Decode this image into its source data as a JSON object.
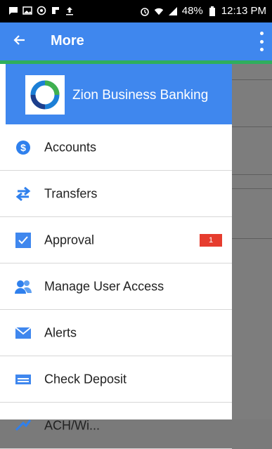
{
  "status_bar": {
    "battery": "48%",
    "time": "12:13 PM",
    "left_icons": [
      "chat-icon",
      "image-icon",
      "circle-icon",
      "flipboard-icon",
      "upload-icon"
    ],
    "right_icons": [
      "alarm-icon",
      "wifi-icon",
      "signal-icon",
      "battery-icon"
    ]
  },
  "app_bar": {
    "title": "More",
    "back_icon": "arrow-left-icon",
    "overflow_icon": "more-vert-icon"
  },
  "drawer": {
    "brand": "Zion Business Banking",
    "items": [
      {
        "label": "Accounts",
        "icon": "dollar-circle-icon"
      },
      {
        "label": "Transfers",
        "icon": "swap-arrows-icon"
      },
      {
        "label": "Approval",
        "icon": "checkbox-icon",
        "badge": "1"
      },
      {
        "label": "Manage User Access",
        "icon": "users-icon"
      },
      {
        "label": "Alerts",
        "icon": "envelope-icon"
      },
      {
        "label": "Check Deposit",
        "icon": "card-icon"
      },
      {
        "label": "ACH/Wi...",
        "icon": "ach-icon"
      }
    ]
  },
  "colors": {
    "primary": "#3f87ee",
    "accent_green": "#2fae5d",
    "badge_red": "#e63c2e"
  }
}
